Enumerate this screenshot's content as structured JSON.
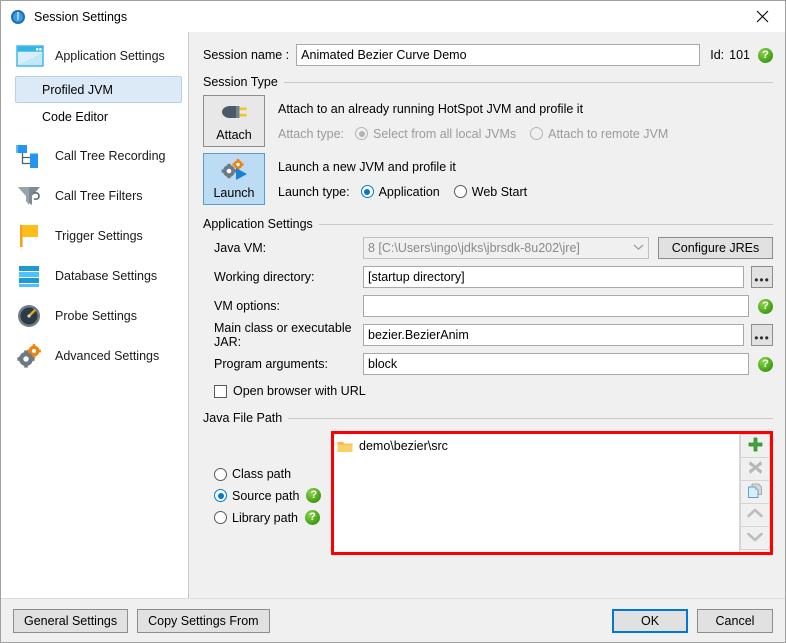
{
  "window": {
    "title": "Session Settings",
    "icon": "info-circle-icon",
    "close_label": "✕"
  },
  "sidebar": {
    "items": [
      {
        "label": "Application Settings",
        "icon": "window-icon",
        "type": "group"
      },
      {
        "label": "Profiled JVM",
        "icon": "",
        "type": "sub",
        "selected": true
      },
      {
        "label": "Code Editor",
        "icon": "",
        "type": "sub",
        "selected": false
      },
      {
        "label": "Call Tree Recording",
        "icon": "tree-icon",
        "type": "group"
      },
      {
        "label": "Call Tree Filters",
        "icon": "funnel-icon",
        "type": "group"
      },
      {
        "label": "Trigger Settings",
        "icon": "flag-icon",
        "type": "group"
      },
      {
        "label": "Database Settings",
        "icon": "database-icon",
        "type": "group"
      },
      {
        "label": "Probe Settings",
        "icon": "gauge-icon",
        "type": "group"
      },
      {
        "label": "Advanced Settings",
        "icon": "gears-icon",
        "type": "group"
      }
    ]
  },
  "session": {
    "name_label": "Session name :",
    "name_value": "Animated Bezier Curve Demo",
    "id_label": "Id:",
    "id_value": "101",
    "help_glyph": "?"
  },
  "session_type": {
    "group_title": "Session Type",
    "attach": {
      "button_label": "Attach",
      "icon": "plug-icon",
      "description": "Attach to an already running HotSpot JVM and profile it",
      "type_label": "Attach type:",
      "enabled": false,
      "options": [
        {
          "label": "Select from all local JVMs",
          "checked": true
        },
        {
          "label": "Attach to remote JVM",
          "checked": false
        }
      ]
    },
    "launch": {
      "button_label": "Launch",
      "icon": "gear-play-icon",
      "description": "Launch a new JVM and profile it",
      "type_label": "Launch type:",
      "selected": true,
      "options": [
        {
          "label": "Application",
          "checked": true
        },
        {
          "label": "Web Start",
          "checked": false
        }
      ]
    }
  },
  "app_settings": {
    "group_title": "Application Settings",
    "java_vm": {
      "label": "Java VM:",
      "value": "8 [C:\\Users\\ingo\\jdks\\jbrsdk-8u202\\jre]",
      "disabled": true,
      "arrow": "⌄",
      "configure_button": "Configure JREs"
    },
    "working_directory": {
      "label": "Working directory:",
      "value": "[startup directory]",
      "browse": "•••"
    },
    "vm_options": {
      "label": "VM options:",
      "value": "",
      "help": "?"
    },
    "main_class": {
      "label": "Main class or executable JAR:",
      "value": "bezier.BezierAnim",
      "browse": "•••"
    },
    "program_arguments": {
      "label": "Program arguments:",
      "value": "block",
      "help": "?"
    },
    "open_browser": {
      "label": "Open browser with URL",
      "checked": false
    }
  },
  "java_file_path": {
    "group_title": "Java File Path",
    "path_types": [
      {
        "label": "Class path",
        "checked": false,
        "help": false
      },
      {
        "label": "Source path",
        "checked": true,
        "help": true
      },
      {
        "label": "Library path",
        "checked": false,
        "help": true
      }
    ],
    "help_glyph": "?",
    "entries": [
      {
        "label": "demo\\bezier\\src",
        "icon": "folder-icon"
      }
    ],
    "tools": [
      {
        "name": "add-path-button",
        "icon": "plus-icon",
        "enabled": true
      },
      {
        "name": "remove-path-button",
        "icon": "x-icon",
        "enabled": false
      },
      {
        "name": "copy-path-button",
        "icon": "copy-icon",
        "enabled": true
      },
      {
        "name": "move-up-button",
        "icon": "chevron-up-icon",
        "enabled": false
      },
      {
        "name": "move-down-button",
        "icon": "chevron-down-icon",
        "enabled": false
      }
    ],
    "highlight_color": "#ff0000"
  },
  "footer": {
    "general_settings": "General Settings",
    "copy_settings_from": "Copy Settings From",
    "ok": "OK",
    "cancel": "Cancel"
  },
  "colors": {
    "accent": "#0078d7",
    "selected_bg": "#dceaf7",
    "launch_active": "#bcdcf4",
    "help_green": "#49a51b",
    "highlight": "#ff0000"
  }
}
